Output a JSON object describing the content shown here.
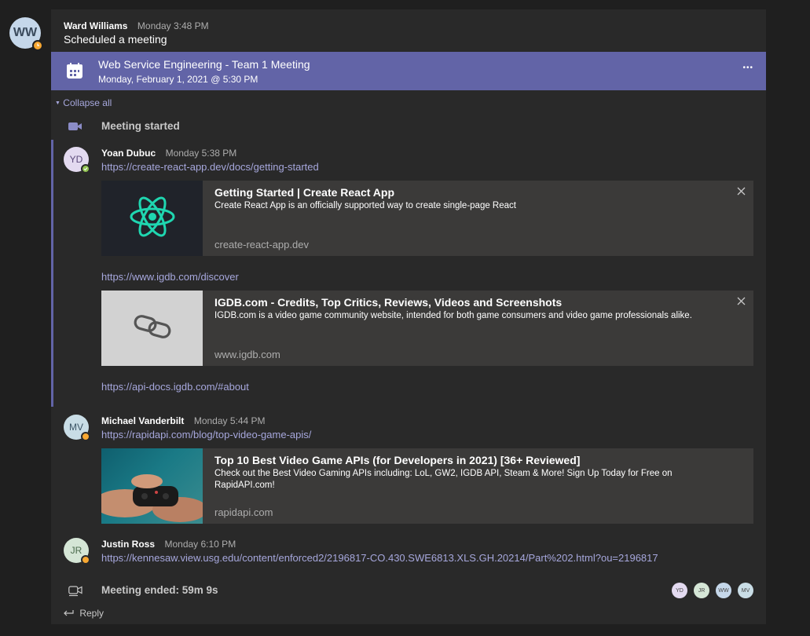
{
  "header": {
    "author": "Ward Williams",
    "time": "Monday 3:48 PM",
    "text": "Scheduled a meeting",
    "avatar_initials": "WW"
  },
  "meeting": {
    "title": "Web Service Engineering - Team 1 Meeting",
    "datetime": "Monday, February 1, 2021 @ 5:30 PM",
    "more_label": "•••"
  },
  "collapse_label": "Collapse all",
  "meeting_started": "Meeting started",
  "messages": [
    {
      "initials": "YD",
      "author": "Yoan Dubuc",
      "time": "Monday 5:38 PM",
      "links": [
        "https://create-react-app.dev/docs/getting-started",
        "https://www.igdb.com/discover",
        "https://api-docs.igdb.com/#about"
      ],
      "previews": [
        {
          "title": "Getting Started | Create React App",
          "description": "Create React App is an officially supported way to create single-page React",
          "domain": "create-react-app.dev",
          "thumb_icon": "react-logo-icon"
        },
        {
          "title": "IGDB.com - Credits, Top Critics, Reviews, Videos and Screenshots",
          "description": "IGDB.com is a video game community website, intended for both game consumers and video game professionals alike.",
          "domain": "www.igdb.com",
          "thumb_icon": "link-icon"
        }
      ]
    },
    {
      "initials": "MV",
      "author": "Michael Vanderbilt",
      "time": "Monday 5:44 PM",
      "links": [
        "https://rapidapi.com/blog/top-video-game-apis/"
      ],
      "previews": [
        {
          "title": "Top 10 Best Video Game APIs (for Developers in 2021) [36+ Reviewed]",
          "description": "Check out the Best Video Gaming APIs including: LoL, GW2, IGDB API, Steam & More! Sign Up Today for Free on RapidAPI.com!",
          "domain": "rapidapi.com",
          "thumb_icon": "game-controller-photo"
        }
      ]
    },
    {
      "initials": "JR",
      "author": "Justin Ross",
      "time": "Monday 6:10 PM",
      "links": [
        "https://kennesaw.view.usg.edu/content/enforced2/2196817-CO.430.SWE6813.XLS.GH.20214/Part%202.html?ou=2196817"
      ]
    }
  ],
  "meeting_ended": "Meeting ended: 59m 9s",
  "participants": [
    "YD",
    "JR",
    "WW",
    "MV"
  ],
  "reply_label": "Reply",
  "colors": {
    "accent": "#6264a7",
    "link": "#a6a7dc",
    "away": "#f8d22a",
    "available": "#92c353"
  }
}
